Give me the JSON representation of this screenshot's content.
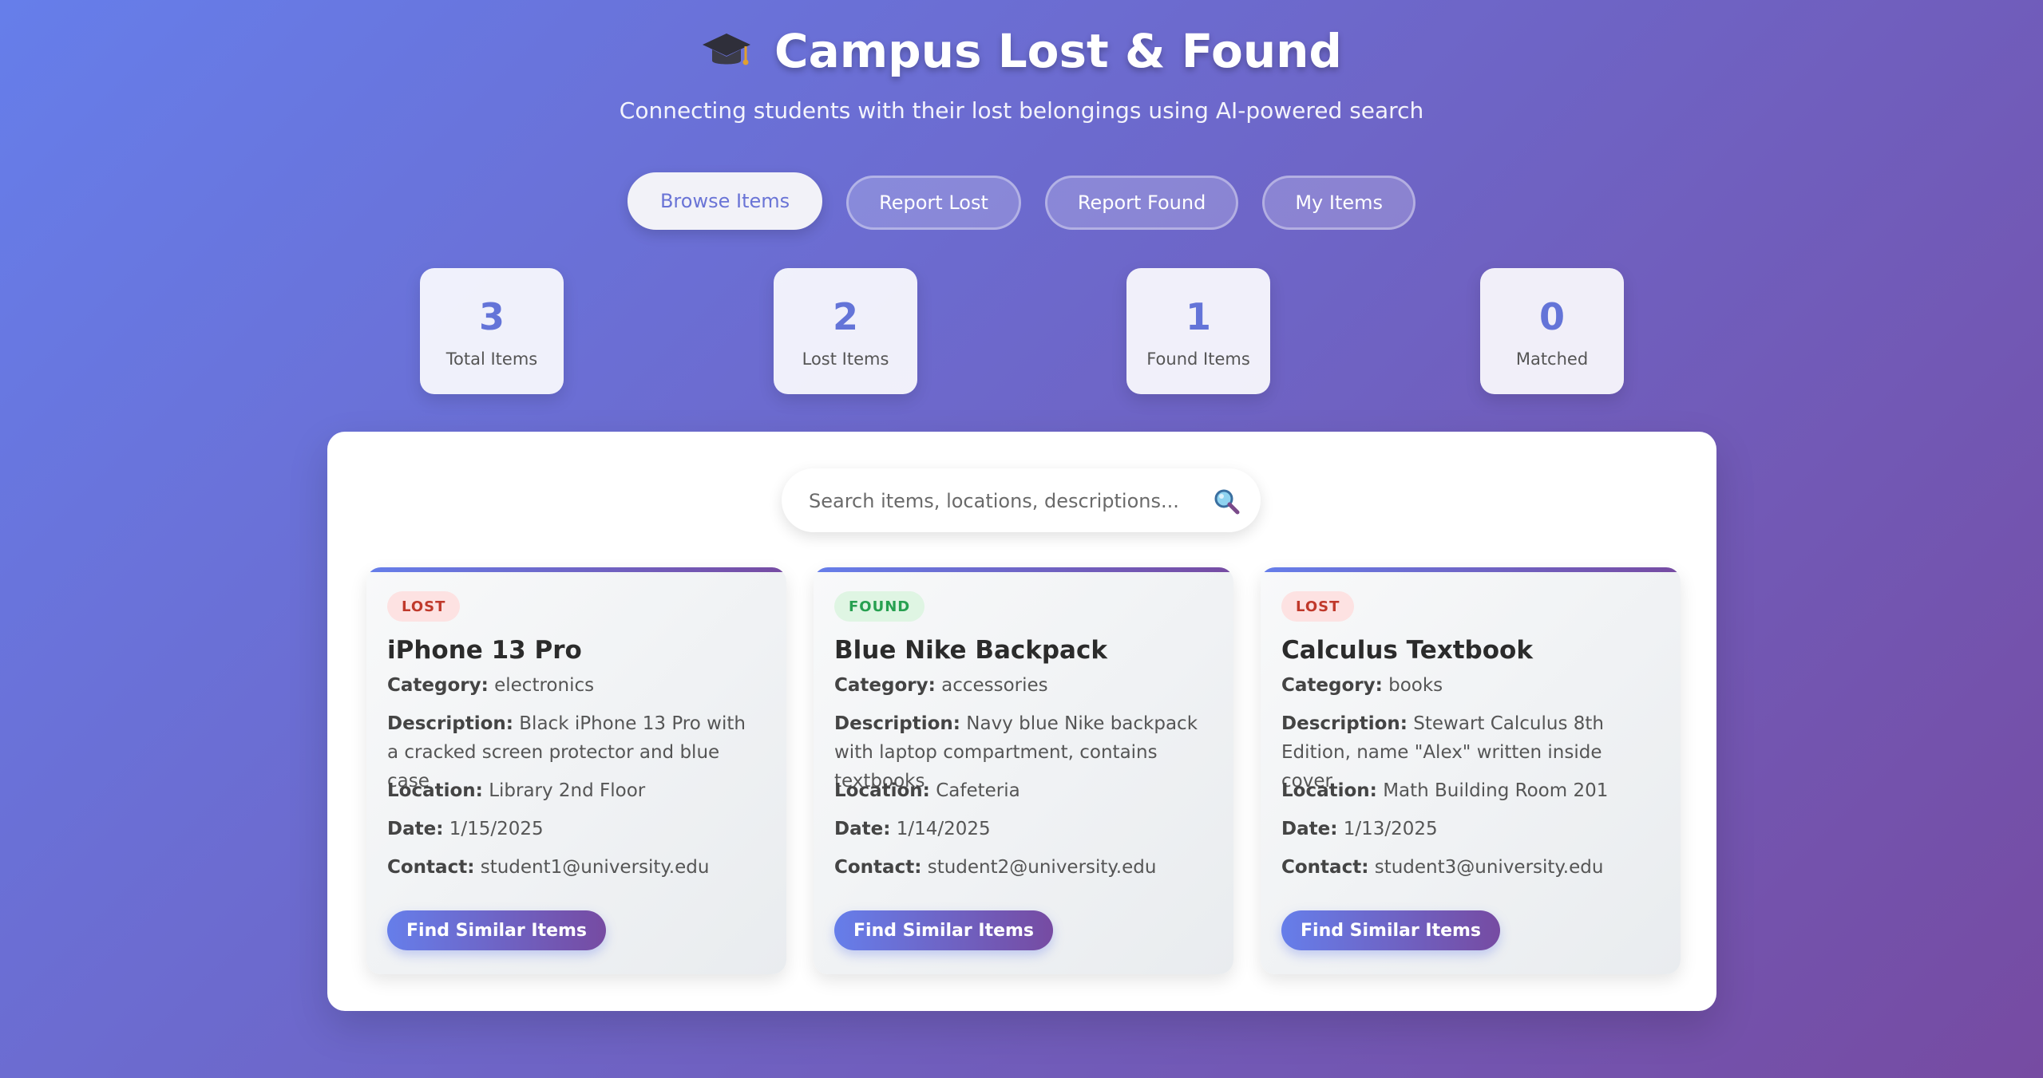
{
  "header": {
    "icon": "graduation-cap-icon",
    "title": "Campus Lost & Found",
    "subtitle": "Connecting students with their lost belongings using AI-powered search"
  },
  "nav": {
    "items": [
      {
        "label": "Browse Items",
        "active": true
      },
      {
        "label": "Report Lost",
        "active": false
      },
      {
        "label": "Report Found",
        "active": false
      },
      {
        "label": "My Items",
        "active": false
      }
    ]
  },
  "stats": [
    {
      "value": "3",
      "label": "Total Items"
    },
    {
      "value": "2",
      "label": "Lost Items"
    },
    {
      "value": "1",
      "label": "Found Items"
    },
    {
      "value": "0",
      "label": "Matched"
    }
  ],
  "search": {
    "placeholder": "Search items, locations, descriptions...",
    "value": "",
    "icon": "search-icon"
  },
  "labels": {
    "category": "Category:",
    "description": "Description:",
    "location": "Location:",
    "date": "Date:",
    "contact": "Contact:"
  },
  "items": [
    {
      "status": "LOST",
      "title": "iPhone 13 Pro",
      "category": "electronics",
      "description": "Black iPhone 13 Pro with a cracked screen protector and blue case",
      "location": "Library 2nd Floor",
      "date": "1/15/2025",
      "contact": "student1@university.edu",
      "button": "Find Similar Items"
    },
    {
      "status": "FOUND",
      "title": "Blue Nike Backpack",
      "category": "accessories",
      "description": "Navy blue Nike backpack with laptop compartment, contains textbooks",
      "location": "Cafeteria",
      "date": "1/14/2025",
      "contact": "student2@university.edu",
      "button": "Find Similar Items"
    },
    {
      "status": "LOST",
      "title": "Calculus Textbook",
      "category": "books",
      "description": "Stewart Calculus 8th Edition, name \"Alex\" written inside cover",
      "location": "Math Building Room 201",
      "date": "1/13/2025",
      "contact": "student3@university.edu",
      "button": "Find Similar Items"
    }
  ],
  "colors": {
    "gradient_start": "#667eea",
    "gradient_end": "#764ba2",
    "lost_badge_bg": "#fde2e2",
    "lost_badge_text": "#c0392b",
    "found_badge_bg": "#dff5e3",
    "found_badge_text": "#27a050"
  }
}
